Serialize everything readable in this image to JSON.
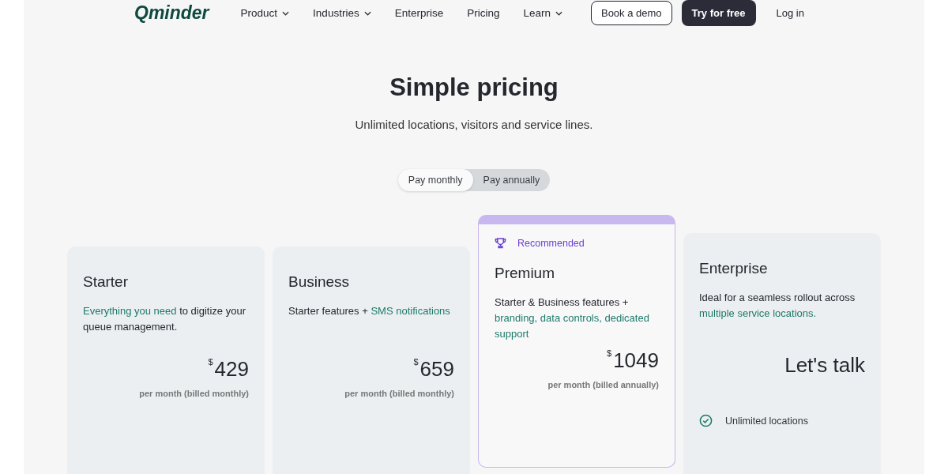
{
  "nav": {
    "logo": "Qminder",
    "links": [
      {
        "label": "Product",
        "dropdown": true
      },
      {
        "label": "Industries",
        "dropdown": true
      },
      {
        "label": "Enterprise",
        "dropdown": false
      },
      {
        "label": "Pricing",
        "dropdown": false
      },
      {
        "label": "Learn",
        "dropdown": true
      }
    ],
    "demo_button": "Book a demo",
    "trial_button": "Try for free",
    "login": "Log in"
  },
  "hero": {
    "title": "Simple pricing",
    "subtitle": "Unlimited locations, visitors and service lines."
  },
  "billing_toggle": [
    {
      "label": "Pay monthly",
      "selected": true
    },
    {
      "label": "Pay annually",
      "selected": false
    }
  ],
  "plans": [
    {
      "kind": "standard",
      "name": "Starter",
      "description": [
        {
          "text": "Everything you need",
          "accent": true
        },
        {
          "text": " to digitize your queue management.",
          "accent": false
        }
      ],
      "currency": "$",
      "price": "429",
      "period": "per month (billed monthly)"
    },
    {
      "kind": "standard",
      "name": "Business",
      "description": [
        {
          "text": "Starter features + ",
          "accent": false
        },
        {
          "text": "SMS notifications",
          "accent": true
        }
      ],
      "currency": "$",
      "price": "659",
      "period": "per month (billed monthly)"
    },
    {
      "kind": "recommended",
      "badge": "Recommended",
      "name": "Premium",
      "description": [
        {
          "text": "Starter & Business features + ",
          "accent": false
        },
        {
          "text": "branding, data controls, dedicated support",
          "accent": true
        }
      ],
      "currency": "$",
      "price": "1049",
      "period": "per month (billed annually)"
    },
    {
      "kind": "enterprise",
      "name": "Enterprise",
      "description": [
        {
          "text": "Ideal for a seamless rollout across ",
          "accent": false
        },
        {
          "text": "multiple service locations.",
          "accent": true
        }
      ],
      "price": "Let's talk",
      "features": [
        "Unlimited locations"
      ]
    }
  ]
}
